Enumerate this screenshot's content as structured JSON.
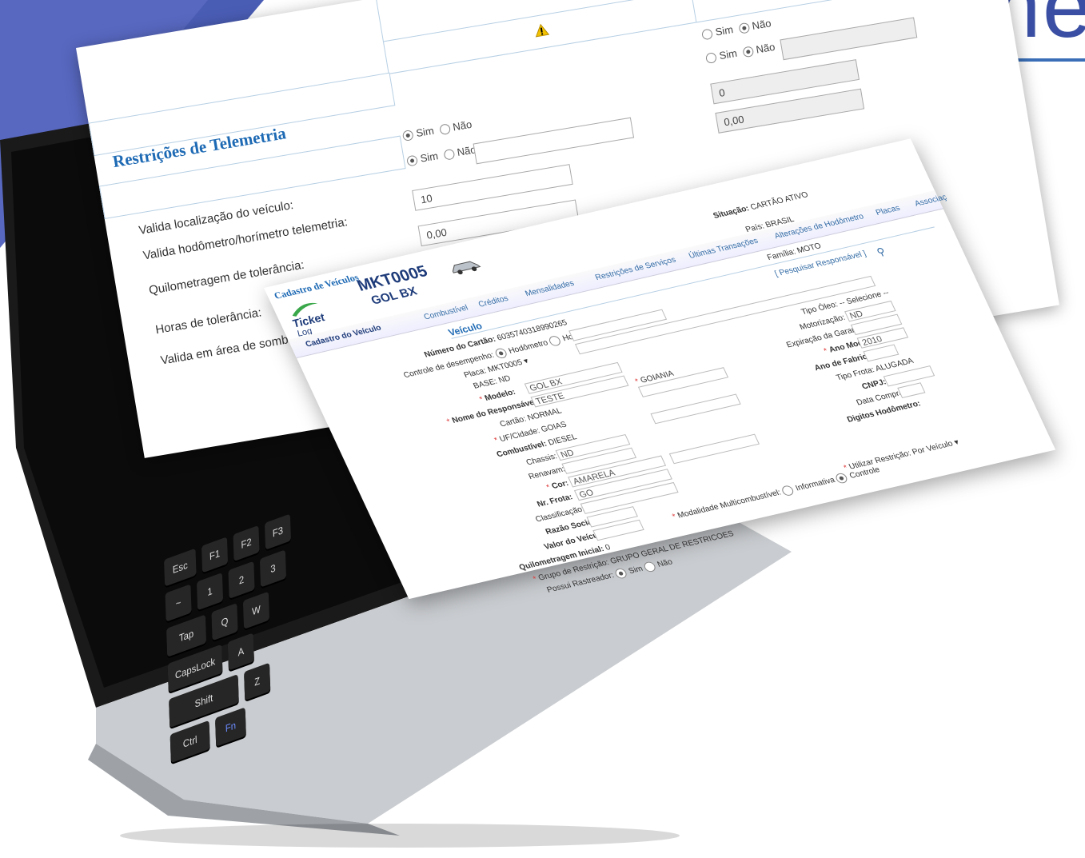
{
  "telemetry": {
    "title": "Restrições de Telemetria",
    "labels": {
      "location": "Valida localização do veículo:",
      "odometer": "Valida hodômetro/horímetro telemetria:",
      "km_tolerance": "Quilometragem de tolerância:",
      "hours_tolerance": "Horas de tolerância:",
      "shadow_area": "Valida em área de sombra:"
    },
    "col1": {
      "sim": "Sim",
      "nao": "Não",
      "km_value": "10",
      "hours_value": "0,00"
    },
    "col2": {
      "sim": "Sim",
      "nao": "Não",
      "km_value": "0",
      "hours_value": "0,00"
    }
  },
  "vehicle": {
    "header": "Cadastro de Veículos",
    "plate": "MKT0005",
    "model_name": "GOL BX",
    "logo_line1": "Ticket",
    "logo_line2": "Log",
    "tabs": [
      "Cadastro do Veículo",
      "Combustível",
      "Créditos",
      "Mensalidades",
      "Restrições de Serviços",
      "Últimas Transações",
      "Alterações de Hodômetro",
      "Placas",
      "Associaç"
    ],
    "section": "Veículo",
    "situacao_label": "Situação:",
    "situacao_value": "CARTÃO ATIVO",
    "pais_label": "País:",
    "pais_value": "BRASIL",
    "familia_label": "Família:",
    "familia_value": "MOTO",
    "pesquisar": "[ Pesquisar Responsável ]",
    "numero_cartao_label": "Número do Cartão:",
    "numero_cartao_value": "6035740318990265",
    "controle_label": "Controle de desempenho:",
    "hodometro": "Hodômetro",
    "horimetro": "Horímetro",
    "placa_label": "Placa:",
    "placa_value": "MKT0005",
    "base_label": "BASE:",
    "base_value": "ND",
    "modelo_label": "Modelo:",
    "modelo_value": "GOL BX",
    "responsavel_label": "Nome do Responsável:",
    "responsavel_value": "TESTE",
    "cartao_label": "Cartão:",
    "cartao_value": "NORMAL",
    "cidade_value": "GOIANIA",
    "uf_label": "UF/Cidade:",
    "uf_value": "GOIAS",
    "combustivel_label": "Combustível:",
    "combustivel_value": "DIESEL",
    "chassis_label": "Chassis:",
    "chassis_value": "ND",
    "renavam_label": "Renavam:",
    "cor_label": "Cor:",
    "cor_value": "AMARELA",
    "frota_label": "Nr. Frota:",
    "frota_value": "GO",
    "classificacao_label": "Classificação:",
    "razao_label": "Razão Social:",
    "valor_label": "Valor do Veículo:",
    "quilometragem_label": "Quilometragem Inicial:",
    "quilometragem_value": "0",
    "grupo_label": "Grupo de Restrição:",
    "grupo_value": "GRUPO GERAL DE RESTRICOES",
    "rastreador_label": "Possui Rastreador:",
    "sim": "Sim",
    "nao": "Não",
    "tipo_oleo_label": "Tipo Óleo:",
    "tipo_oleo_value": "-- Selecione --",
    "motorizacao_label": "Motorização:",
    "motorizacao_value": "ND",
    "expiracao_label": "Expiração da Garantia:",
    "ano_modelo_label": "Ano Modelo:",
    "ano_modelo_value": "2010",
    "ano_fabricacao_label": "Ano de Fabricação:",
    "tipo_frota_label": "Tipo Frota:",
    "tipo_frota_value": "ALUGADA",
    "cnpj_label": "CNPJ:",
    "data_compra_label": "Data Compra:",
    "digitos_label": "Digitos Hodômetro:",
    "modalidade_label": "Modalidade Multicombustível:",
    "informativa": "Informativa",
    "controle": "Controle",
    "utilizar_label": "Utilizar Restrição:",
    "utilizar_value": "Por Veículo"
  },
  "keyboard": [
    "Esc",
    "F1",
    "F2",
    "F3",
    "~",
    "1",
    "@",
    "2",
    "#",
    "3",
    "Tap",
    "Q",
    "W",
    "CapsLock",
    "A",
    "Shift",
    "Z",
    "Ctrl",
    "Fn"
  ],
  "colors": {
    "accent": "#3a4fa3",
    "title_blue": "#1e6ab4"
  }
}
